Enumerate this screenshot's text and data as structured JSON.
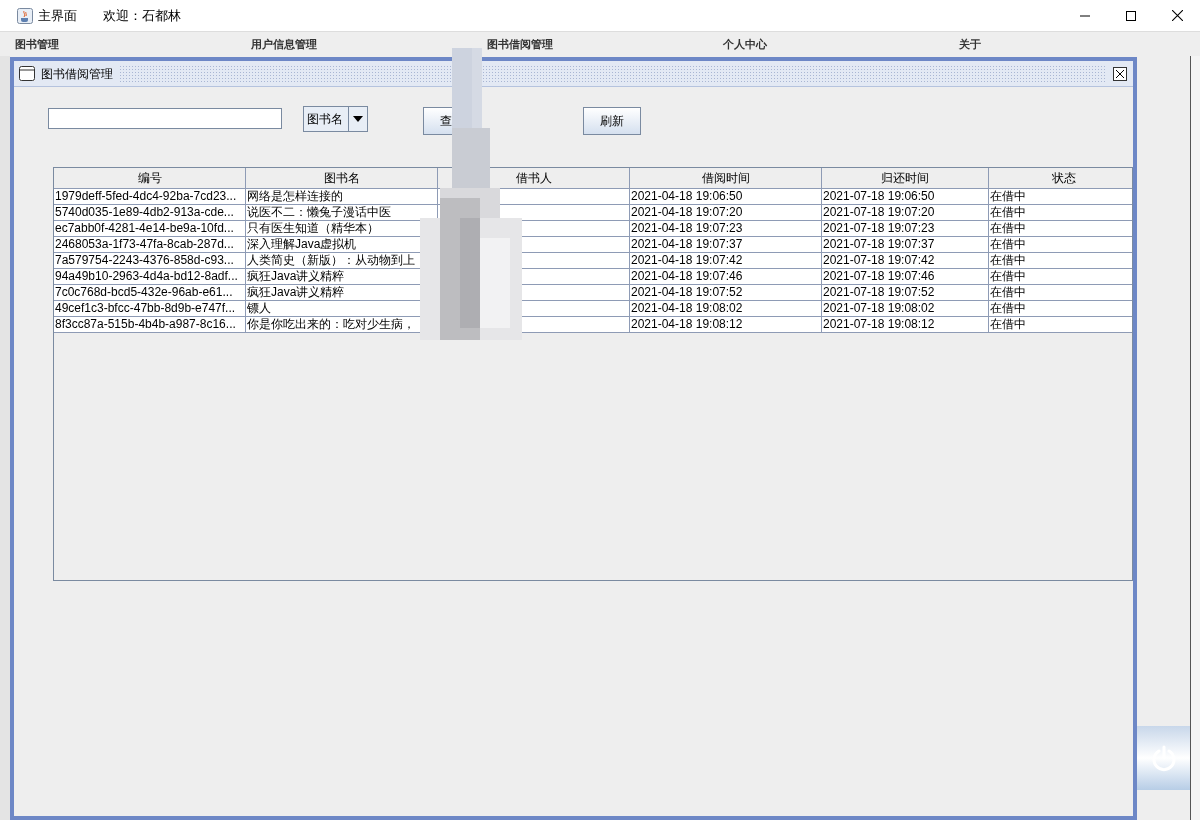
{
  "window": {
    "title": "主界面",
    "welcome": "欢迎：石都林"
  },
  "menu": [
    "图书管理",
    "用户信息管理",
    "图书借阅管理",
    "个人中心",
    "关于"
  ],
  "internal_frame": {
    "title": "图书借阅管理"
  },
  "search_type": {
    "value": "图书名"
  },
  "buttons": [
    "查",
    "刷新"
  ],
  "table": {
    "columns": [
      "编号",
      "图书名",
      "借书人",
      "借阅时间",
      "归还时间",
      "状态"
    ],
    "rows": [
      [
        "1979deff-5fed-4dc4-92ba-7cd23...",
        "网络是怎样连接的",
        "",
        "2021-04-18 19:06:50",
        "2021-07-18 19:06:50",
        "在借中"
      ],
      [
        "5740d035-1e89-4db2-913a-cde...",
        "说医不二：懒兔子漫话中医",
        "",
        "2021-04-18 19:07:20",
        "2021-07-18 19:07:20",
        "在借中"
      ],
      [
        "ec7abb0f-4281-4e14-be9a-10fd...",
        "只有医生知道（精华本）",
        "",
        "2021-04-18 19:07:23",
        "2021-07-18 19:07:23",
        "在借中"
      ],
      [
        "2468053a-1f73-47fa-8cab-287d...",
        "深入理解Java虚拟机",
        "",
        "2021-04-18 19:07:37",
        "2021-07-18 19:07:37",
        "在借中"
      ],
      [
        "7a579754-2243-4376-858d-c93...",
        "人类简史（新版）：从动物到上",
        "",
        "2021-04-18 19:07:42",
        "2021-07-18 19:07:42",
        "在借中"
      ],
      [
        "94a49b10-2963-4d4a-bd12-8adf...",
        "疯狂Java讲义精粹",
        "",
        "2021-04-18 19:07:46",
        "2021-07-18 19:07:46",
        "在借中"
      ],
      [
        "7c0c768d-bcd5-432e-96ab-e61...",
        "疯狂Java讲义精粹",
        "",
        "2021-04-18 19:07:52",
        "2021-07-18 19:07:52",
        "在借中"
      ],
      [
        "49cef1c3-bfcc-47bb-8d9b-e747f...",
        "镖人",
        "",
        "2021-04-18 19:08:02",
        "2021-07-18 19:08:02",
        "在借中"
      ],
      [
        "8f3cc87a-515b-4b4b-a987-8c16...",
        "你是你吃出来的：吃对少生病，",
        "",
        "2021-04-18 19:08:12",
        "2021-07-18 19:08:12",
        "在借中"
      ]
    ]
  }
}
